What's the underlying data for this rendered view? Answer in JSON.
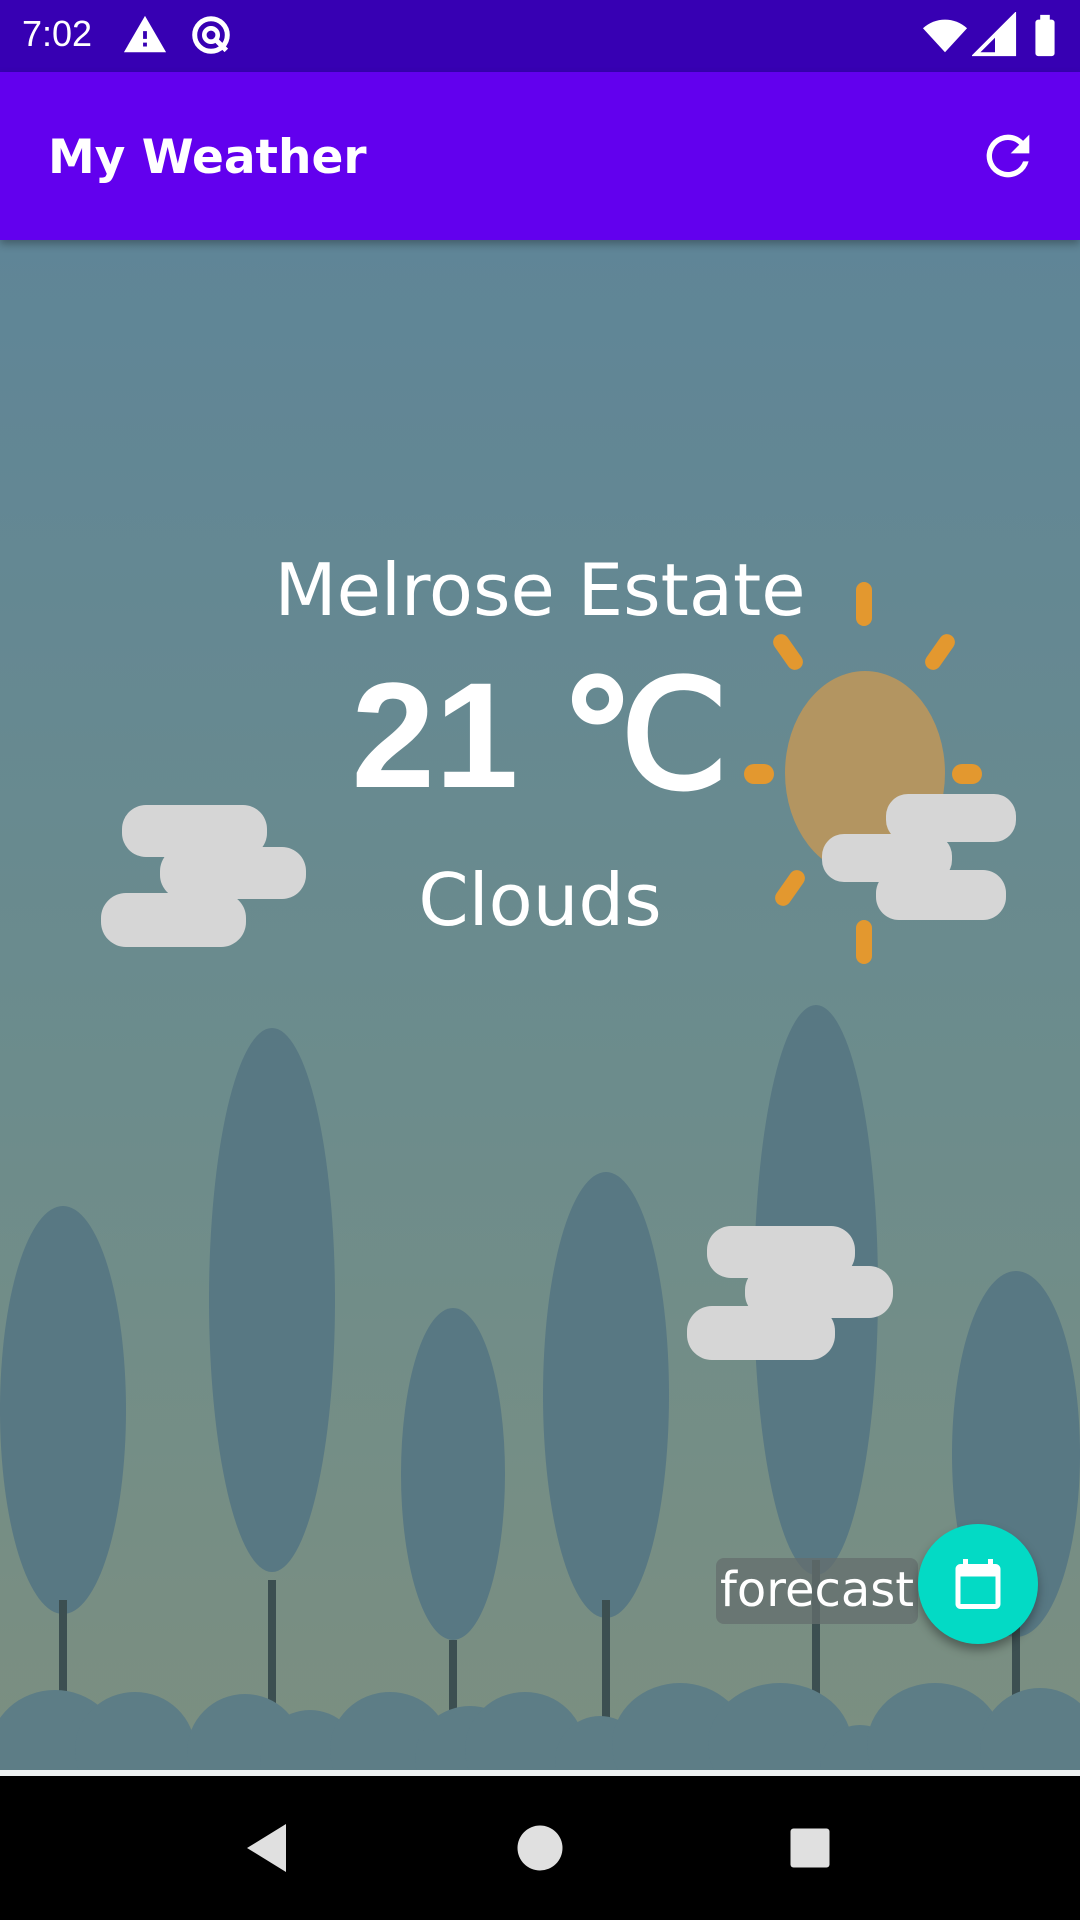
{
  "status_bar": {
    "time": "7:02",
    "icons": [
      "warning-icon",
      "data-saver-icon",
      "wifi-icon",
      "cell-signal-icon",
      "battery-icon"
    ]
  },
  "app_bar": {
    "title": "My Weather",
    "refresh_icon": "refresh-icon"
  },
  "weather": {
    "location": "Melrose Estate",
    "temperature": "21 ℃",
    "condition": "Clouds"
  },
  "fab": {
    "label": "forecast",
    "icon": "calendar-icon"
  },
  "nav_bar": {
    "buttons": [
      "back-icon",
      "home-icon",
      "recents-icon"
    ]
  },
  "colors": {
    "status_bar": "#3700b3",
    "app_bar": "#6200ee",
    "fab": "#03dac5",
    "sky_top": "#5f8597",
    "sky_bottom": "#7c8f80"
  }
}
